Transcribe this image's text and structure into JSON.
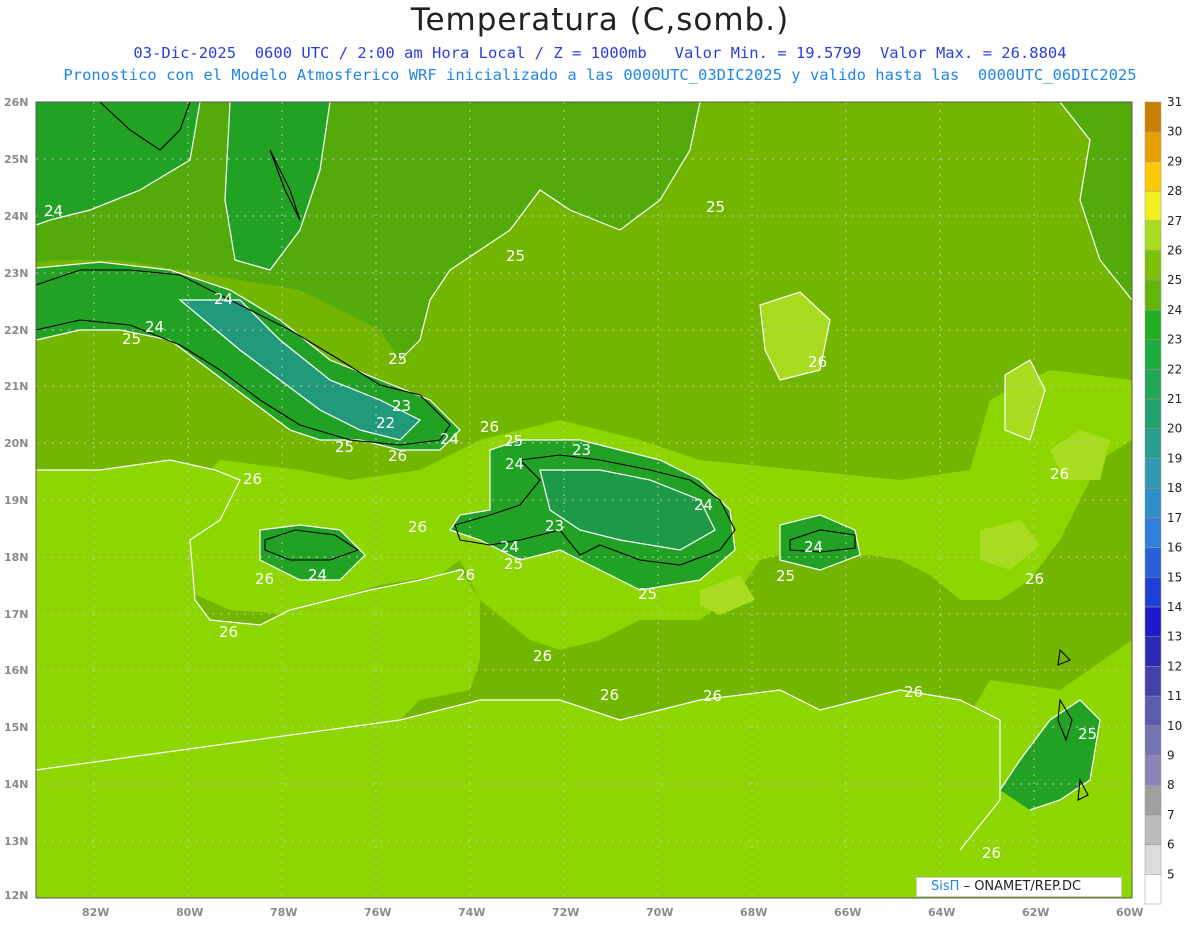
{
  "title": "Temperatura (C,somb.)",
  "subtitle_line1": "03-Dic-2025  0600 UTC / 2:00 am Hora Local / Z = 1000mb   Valor Min. = 19.5799  Valor Max. = 26.8804",
  "subtitle_line2": "Pronostico con el Modelo Atmosferico WRF inicializado a las 0000UTC_03DIC2025 y valido hasta las  0000UTC_06DIC2025",
  "credit_brand": "SisΠ",
  "credit_org": "– ONAMET/REP.DC",
  "lat_labels": [
    "26N",
    "25N",
    "24N",
    "23N",
    "22N",
    "21N",
    "20N",
    "19N",
    "18N",
    "17N",
    "16N",
    "15N",
    "14N",
    "13N",
    "12N"
  ],
  "lon_labels": [
    "82W",
    "80W",
    "78W",
    "76W",
    "74W",
    "72W",
    "70W",
    "68W",
    "66W",
    "64W",
    "62W",
    "60W"
  ],
  "colorbar": {
    "levels": [
      "5",
      "6",
      "7",
      "8",
      "9",
      "10",
      "11",
      "12",
      "13",
      "14",
      "15",
      "16",
      "17",
      "18",
      "19",
      "20",
      "21",
      "22",
      "23",
      "24",
      "25",
      "26",
      "27",
      "28",
      "29",
      "30",
      "31"
    ],
    "colors": [
      "#ffffff",
      "#dcdcdc",
      "#bcbcbc",
      "#a0a0a0",
      "#8e82b8",
      "#7673b5",
      "#5a5cb0",
      "#4242a8",
      "#2a2ab5",
      "#1a1acb",
      "#1e40d8",
      "#2860d8",
      "#2f7fd8",
      "#2f8ec8",
      "#2f9aae",
      "#2a9e8e",
      "#25a070",
      "#20a855",
      "#1eac3c",
      "#22b022",
      "#63b50a",
      "#7ec10a",
      "#a8dc1e",
      "#f0f01e",
      "#ffc800",
      "#e8a000",
      "#c88000"
    ]
  },
  "contour_labels": [
    "24",
    "24",
    "24",
    "25",
    "25",
    "25",
    "25",
    "26",
    "26",
    "25",
    "24",
    "23",
    "22",
    "24",
    "25",
    "26",
    "26",
    "26",
    "24",
    "24",
    "23",
    "24",
    "25",
    "26",
    "26",
    "25",
    "23",
    "24",
    "25",
    "26",
    "26",
    "26",
    "26",
    "26",
    "26",
    "25",
    "26",
    "26"
  ],
  "map_colors": {
    "ocean_base": "#8ed600",
    "zone_26": "#73b600",
    "zone_25": "#52ab0a",
    "zone_24": "#22a225",
    "zone_23": "#1d9a45",
    "zone_22": "#209a7a",
    "warm_patch": "#a8dc1e"
  }
}
